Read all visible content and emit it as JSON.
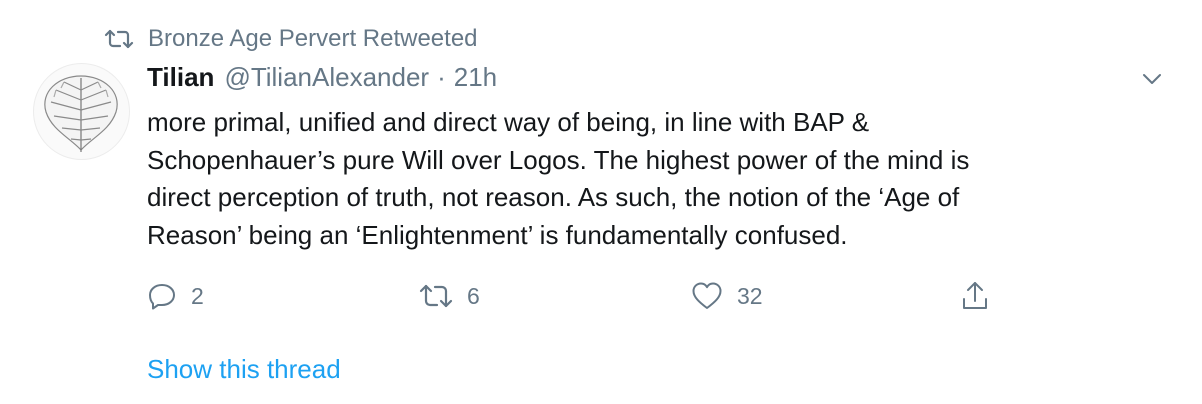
{
  "retweet_banner": {
    "text": "Bronze Age Pervert Retweeted",
    "icon": "retweet-icon"
  },
  "tweet": {
    "author_name": "Tilian",
    "author_handle": "@TilianAlexander",
    "separator": "·",
    "time": "21h",
    "avatar_icon": "leaf-icon",
    "text_lines": [
      "more primal, unified and direct way of being, in line with BAP &",
      "Schopenhauer’s pure Will over Logos. The highest power of the mind is",
      "direct perception of truth, not reason. As such, the notion of the ‘Age of",
      "Reason’ being an ‘Enlightenment’ is fundamentally confused."
    ],
    "actions": {
      "reply_count": "2",
      "retweet_count": "6",
      "like_count": "32"
    },
    "show_thread_label": "Show this thread"
  },
  "colors": {
    "text": "#14171a",
    "secondary": "#657786",
    "link": "#1da1f2"
  }
}
